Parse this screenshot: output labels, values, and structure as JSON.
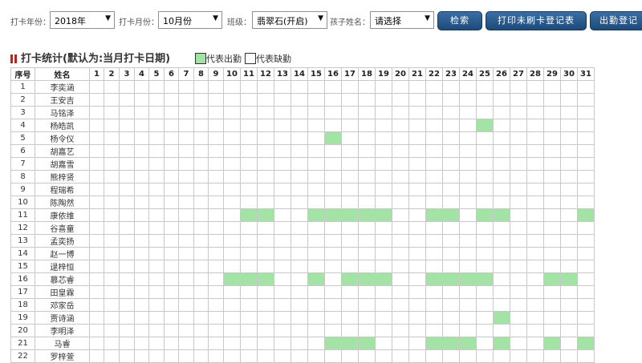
{
  "toolbar": {
    "year_label": "打卡年份：",
    "year_value": "2018年",
    "month_label": "打卡月份：",
    "month_value": "10月份",
    "class_label": "班级：",
    "class_value": "翡翠石(开启)",
    "child_label": "孩子姓名：",
    "child_value": "请选择",
    "search_button": "检索",
    "print_button": "打印未刷卡登记表",
    "attendance_button": "出勤登记"
  },
  "section": {
    "title": "打卡统计(默认为:当月打卡日期)",
    "legend_present": "代表出勤",
    "legend_absent": "代表缺勤"
  },
  "colors": {
    "present": "#a3e3a6",
    "absent": "#ffffff",
    "button": "#1f4d7e"
  },
  "table": {
    "header_index": "序号",
    "header_name": "姓名",
    "days": [
      "1",
      "2",
      "3",
      "4",
      "5",
      "6",
      "7",
      "8",
      "9",
      "10",
      "11",
      "12",
      "13",
      "14",
      "15",
      "16",
      "17",
      "18",
      "19",
      "20",
      "21",
      "22",
      "23",
      "24",
      "25",
      "26",
      "27",
      "28",
      "29",
      "30",
      "31"
    ],
    "rows": [
      {
        "index": "1",
        "name": "李奕涵",
        "present": []
      },
      {
        "index": "2",
        "name": "王安吉",
        "present": []
      },
      {
        "index": "3",
        "name": "马铭泽",
        "present": []
      },
      {
        "index": "4",
        "name": "杨皓凯",
        "present": [
          25
        ]
      },
      {
        "index": "5",
        "name": "杨令仪",
        "present": [
          16
        ]
      },
      {
        "index": "6",
        "name": "胡嘉艺",
        "present": []
      },
      {
        "index": "7",
        "name": "胡嘉雪",
        "present": []
      },
      {
        "index": "8",
        "name": "熊梓贤",
        "present": []
      },
      {
        "index": "9",
        "name": "程瑞希",
        "present": []
      },
      {
        "index": "10",
        "name": "陈陶然",
        "present": []
      },
      {
        "index": "11",
        "name": "康依维",
        "present": [
          11,
          12,
          15,
          16,
          17,
          18,
          19,
          22,
          23,
          25,
          26,
          31
        ]
      },
      {
        "index": "12",
        "name": "谷喜童",
        "present": []
      },
      {
        "index": "13",
        "name": "孟奕扬",
        "present": []
      },
      {
        "index": "14",
        "name": "赵一博",
        "present": []
      },
      {
        "index": "15",
        "name": "逯梓恒",
        "present": []
      },
      {
        "index": "16",
        "name": "慕芯睿",
        "present": [
          10,
          11,
          12,
          15,
          17,
          18,
          19,
          22,
          23,
          24,
          25,
          29,
          30
        ]
      },
      {
        "index": "17",
        "name": "田皇霖",
        "present": []
      },
      {
        "index": "18",
        "name": "邓家岳",
        "present": []
      },
      {
        "index": "19",
        "name": "贾诗涵",
        "present": [
          26
        ]
      },
      {
        "index": "20",
        "name": "李明泽",
        "present": []
      },
      {
        "index": "21",
        "name": "马睿",
        "present": [
          16,
          17,
          18,
          22,
          23,
          24,
          26,
          29,
          31
        ]
      },
      {
        "index": "22",
        "name": "罗梓萱",
        "present": []
      }
    ]
  }
}
